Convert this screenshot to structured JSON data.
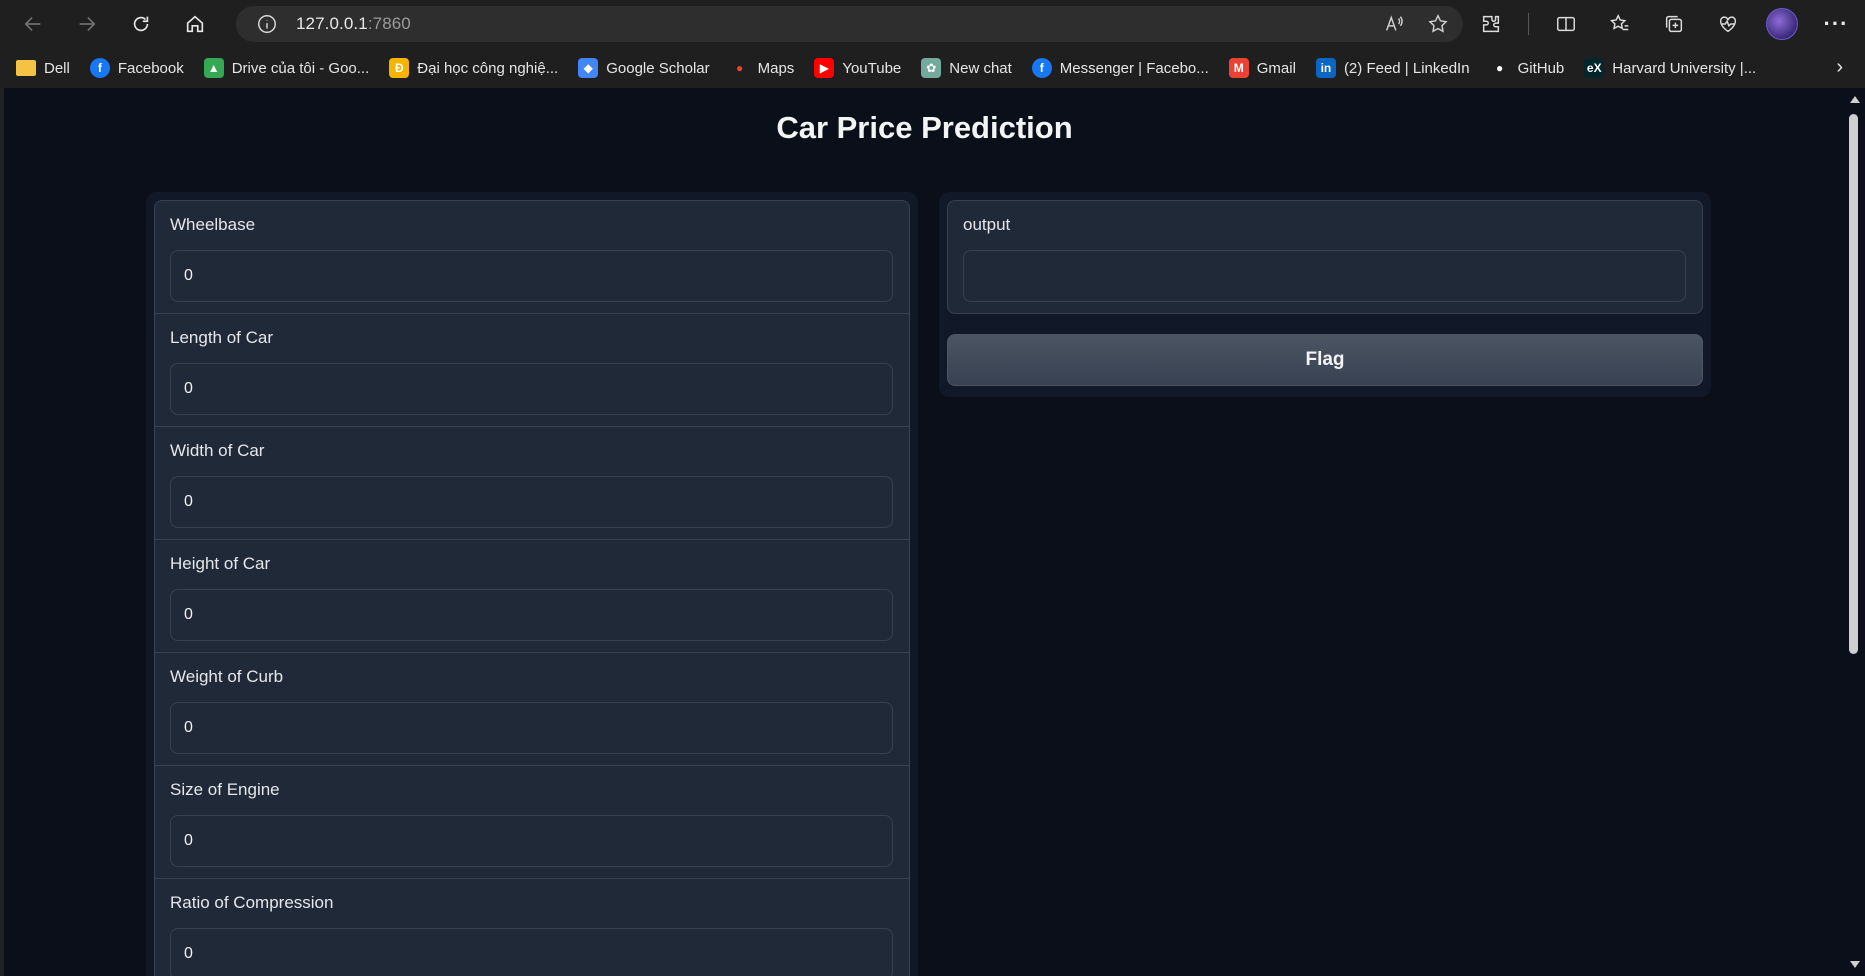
{
  "browser": {
    "url_host": "127.0.0.1",
    "url_port": ":7860",
    "bookmarks": [
      {
        "label": "Dell",
        "icon": "folder-icon",
        "color": "#f5c343"
      },
      {
        "label": "Facebook",
        "icon": "facebook-icon",
        "color": "#1877f2"
      },
      {
        "label": "Drive của tôi - Goo...",
        "icon": "google-drive-icon",
        "color": "#34a853"
      },
      {
        "label": "Đại học công nghiệ...",
        "icon": "university-icon",
        "color": "#f4b400"
      },
      {
        "label": "Google Scholar",
        "icon": "google-scholar-icon",
        "color": "#4285f4"
      },
      {
        "label": "Maps",
        "icon": "maps-icon",
        "color": "#ea4335"
      },
      {
        "label": "YouTube",
        "icon": "youtube-icon",
        "color": "#ff0000"
      },
      {
        "label": "New chat",
        "icon": "chatgpt-icon",
        "color": "#74aa9c"
      },
      {
        "label": "Messenger | Facebo...",
        "icon": "facebook-icon",
        "color": "#1877f2"
      },
      {
        "label": "Gmail",
        "icon": "gmail-icon",
        "color": "#ea4335"
      },
      {
        "label": "(2) Feed | LinkedIn",
        "icon": "linkedin-icon",
        "color": "#0a66c2"
      },
      {
        "label": "GitHub",
        "icon": "github-icon",
        "color": "#ffffff"
      },
      {
        "label": "Harvard University |...",
        "icon": "edx-icon",
        "color": "#02262b"
      }
    ]
  },
  "app": {
    "title": "Car Price Prediction",
    "inputs": [
      {
        "label": "Wheelbase",
        "value": "0"
      },
      {
        "label": "Length of Car",
        "value": "0"
      },
      {
        "label": "Width of Car",
        "value": "0"
      },
      {
        "label": "Height of Car",
        "value": "0"
      },
      {
        "label": "Weight of Curb",
        "value": "0"
      },
      {
        "label": "Size of Engine",
        "value": "0"
      },
      {
        "label": "Ratio of Compression",
        "value": "0"
      }
    ],
    "output": {
      "label": "output",
      "value": ""
    },
    "flag_label": "Flag"
  }
}
